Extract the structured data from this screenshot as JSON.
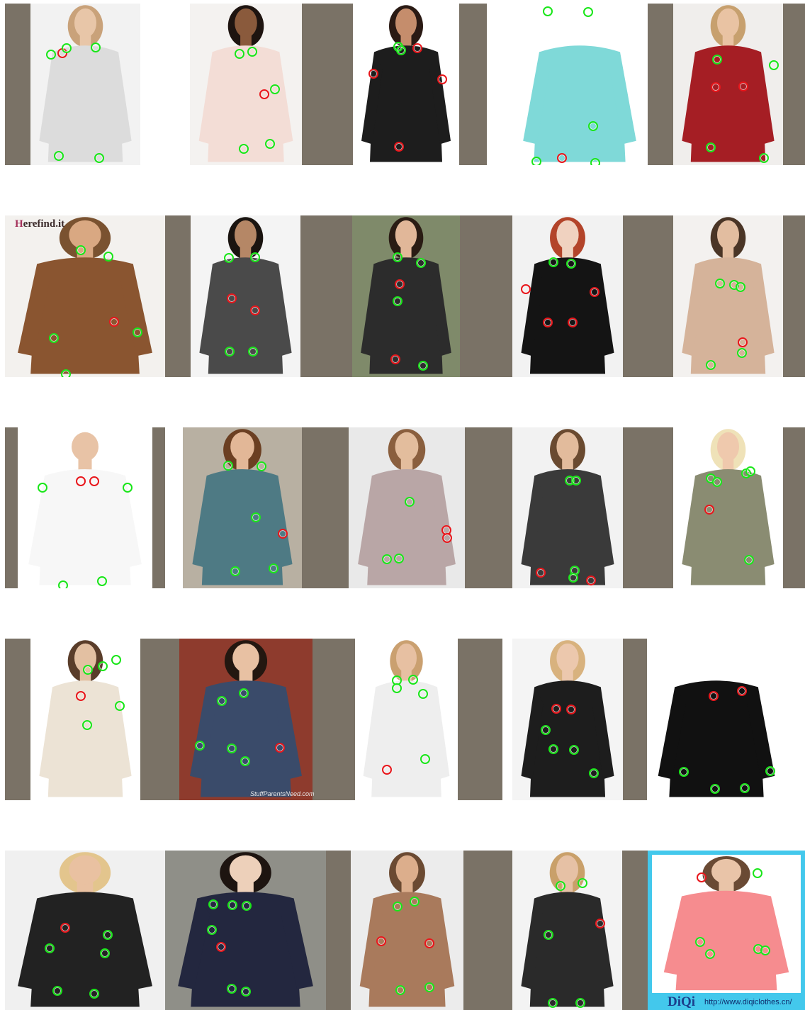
{
  "palette": {
    "frame": "#7a7266",
    "good_keypoint": "#19e619",
    "bad_keypoint": "#e8161b",
    "diqi_border": "#43c8ec"
  },
  "watermarks": {
    "herefind_h": "H",
    "herefind_rest": "erefind.it",
    "stuffparents": "StuffParentsNeed.com",
    "diqi_logo": "DiQi",
    "diqi_url": "http://www.diqiclothes.cn/"
  },
  "tiles": [
    {
      "id": "r1c1",
      "bg": "#f2f2f2",
      "garment": "#dcdcdc",
      "skin": "#e8c6a8",
      "hair": "#c9a27a",
      "kp": [
        [
          72,
          77,
          "g"
        ],
        [
          88,
          75,
          "r"
        ],
        [
          94,
          68,
          "g"
        ],
        [
          135,
          67,
          "g"
        ],
        [
          83,
          220,
          "g"
        ],
        [
          140,
          223,
          "g"
        ]
      ]
    },
    {
      "id": "r1c2",
      "bg": "#f4f2f0",
      "garment": "#f3ddd6",
      "skin": "#8a5a3c",
      "hair": "#1e1410",
      "kp": [
        [
          338,
          76,
          "g"
        ],
        [
          356,
          73,
          "g"
        ],
        [
          388,
          126,
          "g"
        ],
        [
          373,
          133,
          "r"
        ],
        [
          344,
          210,
          "g"
        ],
        [
          381,
          203,
          "g"
        ]
      ]
    },
    {
      "id": "r1c3",
      "bg": "#ffffff",
      "garment": "#1d1d1d",
      "skin": "#c58d6c",
      "hair": "#2a1a14",
      "kp": [
        [
          562,
          66,
          "g"
        ],
        [
          566,
          71,
          "g"
        ],
        [
          589,
          68,
          "r"
        ],
        [
          527,
          104,
          "r"
        ],
        [
          624,
          112,
          "r"
        ],
        [
          563,
          207,
          "r"
        ]
      ]
    },
    {
      "id": "r1c4",
      "bg": "#ffffff",
      "garment": "#7fd9d8",
      "skin": "#ffffff",
      "hair": "#ffffff",
      "kp": [
        [
          773,
          16,
          "g"
        ],
        [
          830,
          17,
          "g"
        ],
        [
          837,
          178,
          "g"
        ],
        [
          757,
          228,
          "g"
        ],
        [
          793,
          223,
          "r"
        ],
        [
          840,
          230,
          "g"
        ]
      ]
    },
    {
      "id": "r1c5",
      "bg": "#f0eeec",
      "garment": "#a51e24",
      "skin": "#e9c3a3",
      "hair": "#c7a06e",
      "kp": [
        [
          1012,
          84,
          "g"
        ],
        [
          1092,
          92,
          "g"
        ],
        [
          1010,
          123,
          "r"
        ],
        [
          1049,
          122,
          "r"
        ],
        [
          1003,
          208,
          "g"
        ],
        [
          1078,
          223,
          "g"
        ]
      ]
    },
    {
      "id": "r2c1",
      "bg": "#f3f1ee",
      "garment": "#8a5530",
      "skin": "#d9a882",
      "hair": "#7a5230",
      "kp": [
        [
          114,
          353,
          "g"
        ],
        [
          153,
          362,
          "g"
        ],
        [
          161,
          454,
          "r"
        ],
        [
          76,
          477,
          "g"
        ],
        [
          194,
          469,
          "g"
        ],
        [
          93,
          528,
          "g"
        ]
      ]
    },
    {
      "id": "r2c2",
      "bg": "#f4f4f4",
      "garment": "#4a4a4a",
      "skin": "#b58766",
      "hair": "#1a1410",
      "kp": [
        [
          323,
          364,
          "g"
        ],
        [
          360,
          363,
          "g"
        ],
        [
          327,
          421,
          "r"
        ],
        [
          360,
          438,
          "r"
        ],
        [
          324,
          496,
          "g"
        ],
        [
          357,
          496,
          "g"
        ]
      ]
    },
    {
      "id": "r2c3",
      "bg": "#7f8a6a",
      "garment": "#2c2c2c",
      "skin": "#e1b799",
      "hair": "#2a1c14",
      "kp": [
        [
          561,
          363,
          "g"
        ],
        [
          594,
          371,
          "g"
        ],
        [
          564,
          401,
          "r"
        ],
        [
          561,
          425,
          "g"
        ],
        [
          558,
          507,
          "r"
        ],
        [
          597,
          516,
          "g"
        ]
      ]
    },
    {
      "id": "r2c4",
      "bg": "#f2f2f2",
      "garment": "#141414",
      "skin": "#f0d2c0",
      "hair": "#b3442a",
      "kp": [
        [
          781,
          370,
          "g"
        ],
        [
          806,
          372,
          "g"
        ],
        [
          742,
          408,
          "r"
        ],
        [
          839,
          412,
          "r"
        ],
        [
          773,
          455,
          "r"
        ],
        [
          808,
          455,
          "r"
        ]
      ]
    },
    {
      "id": "r2c5",
      "bg": "#f3f1ef",
      "garment": "#d5b39a",
      "skin": "#e2bda0",
      "hair": "#4a3526",
      "kp": [
        [
          1016,
          400,
          "g"
        ],
        [
          1036,
          402,
          "g"
        ],
        [
          1045,
          405,
          "g"
        ],
        [
          1048,
          483,
          "r"
        ],
        [
          1047,
          498,
          "g"
        ],
        [
          1003,
          515,
          "g"
        ]
      ]
    },
    {
      "id": "r3c1",
      "bg": "#ffffff",
      "garment": "#f7f7f7",
      "skin": "#e8c3a6",
      "hair": "#ffffff",
      "kp": [
        [
          60,
          688,
          "g"
        ],
        [
          114,
          679,
          "r"
        ],
        [
          133,
          679,
          "r"
        ],
        [
          180,
          688,
          "g"
        ],
        [
          89,
          826,
          "g"
        ],
        [
          144,
          820,
          "g"
        ]
      ]
    },
    {
      "id": "r3c2",
      "bg": "#b8b0a2",
      "garment": "#4e7a84",
      "skin": "#e2b797",
      "hair": "#6b3f22",
      "kp": [
        [
          322,
          657,
          "g"
        ],
        [
          369,
          658,
          "g"
        ],
        [
          361,
          730,
          "g"
        ],
        [
          399,
          753,
          "r"
        ],
        [
          332,
          806,
          "g"
        ],
        [
          386,
          802,
          "g"
        ]
      ]
    },
    {
      "id": "r3c3",
      "bg": "#e9e9e9",
      "garment": "#b9a6a6",
      "skin": "#e3bd9d",
      "hair": "#8a5f3e",
      "kp": [
        [
          578,
          708,
          "g"
        ],
        [
          630,
          748,
          "r"
        ],
        [
          631,
          759,
          "r"
        ],
        [
          546,
          789,
          "g"
        ],
        [
          563,
          788,
          "g"
        ]
      ]
    },
    {
      "id": "r3c4",
      "bg": "#f2f2f2",
      "garment": "#3a3a3a",
      "skin": "#e2bb9c",
      "hair": "#6a4a30",
      "kp": [
        [
          804,
          678,
          "g"
        ],
        [
          813,
          678,
          "g"
        ],
        [
          763,
          808,
          "r"
        ],
        [
          811,
          805,
          "g"
        ],
        [
          809,
          815,
          "g"
        ],
        [
          834,
          819,
          "r"
        ]
      ]
    },
    {
      "id": "r3c5",
      "bg": "#ffffff",
      "garment": "#8a8c72",
      "skin": "#efc9ad",
      "hair": "#efe2b8",
      "kp": [
        [
          1003,
          675,
          "g"
        ],
        [
          1012,
          680,
          "g"
        ],
        [
          1053,
          668,
          "g"
        ],
        [
          1059,
          665,
          "g"
        ],
        [
          1001,
          719,
          "r"
        ],
        [
          1057,
          790,
          "g"
        ]
      ]
    },
    {
      "id": "r4c1",
      "bg": "#ffffff",
      "garment": "#ece3d5",
      "skin": "#e3c0a2",
      "hair": "#5a3d2a",
      "kp": [
        [
          124,
          945,
          "g"
        ],
        [
          145,
          940,
          "g"
        ],
        [
          164,
          931,
          "g"
        ],
        [
          114,
          982,
          "r"
        ],
        [
          169,
          996,
          "g"
        ],
        [
          123,
          1023,
          "g"
        ]
      ]
    },
    {
      "id": "r4c2",
      "bg": "#8e3b2d",
      "garment": "#3a4b6a",
      "skin": "#e8c1a3",
      "hair": "#231710",
      "kp": [
        [
          313,
          989,
          "g"
        ],
        [
          344,
          978,
          "g"
        ],
        [
          282,
          1052,
          "g"
        ],
        [
          327,
          1056,
          "g"
        ],
        [
          395,
          1055,
          "r"
        ],
        [
          346,
          1074,
          "g"
        ]
      ]
    },
    {
      "id": "r4c3",
      "bg": "#ffffff",
      "garment": "#eeeeee",
      "skin": "#e7c0a2",
      "hair": "#caa070",
      "kp": [
        [
          560,
          960,
          "g"
        ],
        [
          583,
          959,
          "g"
        ],
        [
          560,
          971,
          "g"
        ],
        [
          597,
          979,
          "g"
        ],
        [
          600,
          1071,
          "g"
        ],
        [
          546,
          1086,
          "r"
        ]
      ]
    },
    {
      "id": "r4c4",
      "bg": "#f4f4f4",
      "garment": "#1d1d1d",
      "skin": "#ecc8ad",
      "hair": "#d8b27e",
      "kp": [
        [
          785,
          1000,
          "r"
        ],
        [
          806,
          1001,
          "r"
        ],
        [
          770,
          1030,
          "g"
        ],
        [
          781,
          1057,
          "g"
        ],
        [
          810,
          1058,
          "g"
        ],
        [
          838,
          1091,
          "g"
        ]
      ]
    },
    {
      "id": "r4c5",
      "bg": "#ffffff",
      "garment": "#111111",
      "skin": "#ffffff",
      "hair": "#ffffff",
      "kp": [
        [
          1007,
          982,
          "r"
        ],
        [
          1047,
          975,
          "r"
        ],
        [
          965,
          1089,
          "g"
        ],
        [
          1087,
          1088,
          "g"
        ],
        [
          1009,
          1113,
          "g"
        ],
        [
          1051,
          1112,
          "g"
        ]
      ]
    },
    {
      "id": "r5c1",
      "bg": "#f0f0f0",
      "garment": "#222222",
      "skin": "#e9c1a1",
      "hair": "#e3c58d",
      "kp": [
        [
          92,
          1309,
          "r"
        ],
        [
          152,
          1319,
          "g"
        ],
        [
          70,
          1338,
          "g"
        ],
        [
          148,
          1345,
          "g"
        ],
        [
          81,
          1398,
          "g"
        ],
        [
          133,
          1402,
          "g"
        ]
      ]
    },
    {
      "id": "r5c2",
      "bg": "#8f8f88",
      "garment": "#23273f",
      "skin": "#edd0ba",
      "hair": "#1d1410",
      "kp": [
        [
          301,
          1276,
          "g"
        ],
        [
          328,
          1277,
          "g"
        ],
        [
          348,
          1278,
          "g"
        ],
        [
          299,
          1312,
          "g"
        ],
        [
          312,
          1336,
          "r"
        ],
        [
          327,
          1395,
          "g"
        ],
        [
          347,
          1399,
          "g"
        ]
      ]
    },
    {
      "id": "r5c3",
      "bg": "#ececec",
      "garment": "#a97a5c",
      "skin": "#dcae8c",
      "hair": "#6b4a32",
      "kp": [
        [
          561,
          1279,
          "g"
        ],
        [
          585,
          1272,
          "g"
        ],
        [
          538,
          1328,
          "r"
        ],
        [
          606,
          1331,
          "r"
        ],
        [
          565,
          1397,
          "g"
        ],
        [
          606,
          1393,
          "g"
        ]
      ]
    },
    {
      "id": "r5c4",
      "bg": "#f3f3f3",
      "garment": "#2a2a2a",
      "skin": "#e6c1a5",
      "hair": "#c9a06a",
      "kp": [
        [
          791,
          1250,
          "g"
        ],
        [
          822,
          1246,
          "g"
        ],
        [
          847,
          1303,
          "r"
        ],
        [
          774,
          1319,
          "g"
        ],
        [
          780,
          1415,
          "g"
        ],
        [
          819,
          1415,
          "g"
        ]
      ]
    },
    {
      "id": "r5c5",
      "bg": "#ffffff",
      "garment": "#f68c8f",
      "skin": "#e9c4a8",
      "hair": "#6a4a34",
      "kp": [
        [
          990,
          1238,
          "r"
        ],
        [
          1069,
          1232,
          "g"
        ],
        [
          988,
          1329,
          "g"
        ],
        [
          1002,
          1346,
          "g"
        ],
        [
          1070,
          1339,
          "g"
        ],
        [
          1080,
          1341,
          "g"
        ]
      ]
    }
  ]
}
